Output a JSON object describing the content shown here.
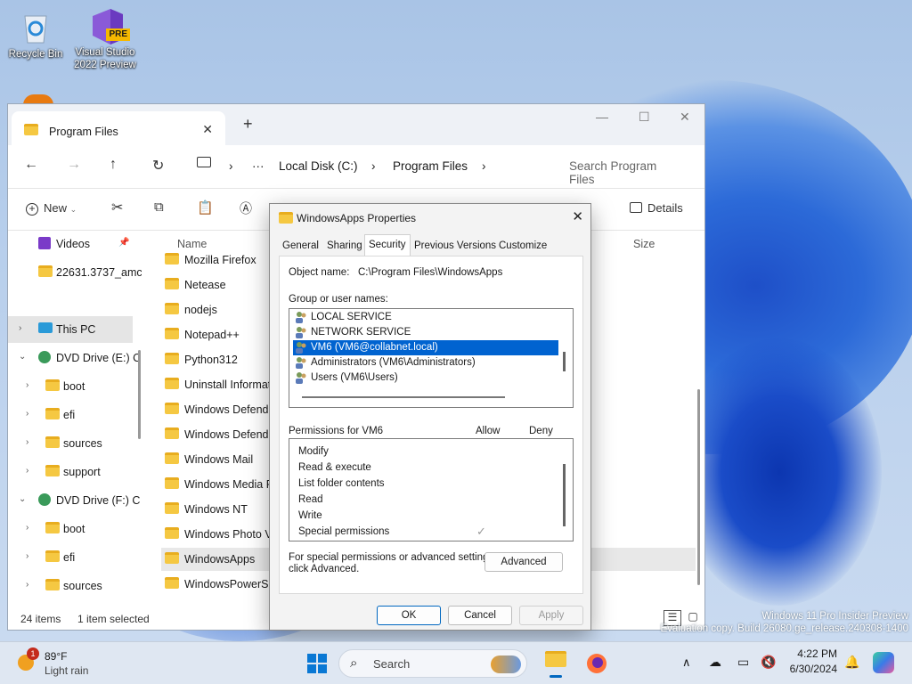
{
  "desktop": {
    "icons": [
      {
        "label": "Recycle Bin"
      },
      {
        "label": "Visual Studio 2022 Preview",
        "badge": "PRE"
      }
    ],
    "watermark_line1": "Windows 11 Pro Insider Preview",
    "watermark_line2": "Evaluation copy. Build 26080.ge_release.240308-1400"
  },
  "explorer": {
    "tab_title": "Program Files",
    "address": {
      "breadcrumb_1": "Local Disk (C:)",
      "breadcrumb_2": "Program Files",
      "search_placeholder": "Search Program Files"
    },
    "commands": {
      "new_label": "New",
      "details_label": "Details"
    },
    "nav": [
      {
        "label": "Videos"
      },
      {
        "label": "22631.3737_amc"
      },
      {
        "label": "This PC"
      },
      {
        "label": "DVD Drive (E:) C"
      },
      {
        "label": "boot"
      },
      {
        "label": "efi"
      },
      {
        "label": "sources"
      },
      {
        "label": "support"
      },
      {
        "label": "DVD Drive (F:) C"
      },
      {
        "label": "boot"
      },
      {
        "label": "efi"
      },
      {
        "label": "sources"
      }
    ],
    "columns": {
      "name": "Name",
      "size": "Size"
    },
    "files": [
      "Mozilla Firefox",
      "Netease",
      "nodejs",
      "Notepad++",
      "Python312",
      "Uninstall Informati",
      "Windows Defende",
      "Windows Defende",
      "Windows Mail",
      "Windows Media Pl",
      "Windows NT",
      "Windows Photo Vi",
      "WindowsApps",
      "WindowsPowerShe"
    ],
    "status": {
      "count": "24 items",
      "selected": "1 item selected"
    }
  },
  "dialog": {
    "title": "WindowsApps Properties",
    "tabs": [
      "General",
      "Sharing",
      "Security",
      "Previous Versions",
      "Customize"
    ],
    "active_tab": "Security",
    "object_name_label": "Object name:",
    "object_name_value": "C:\\Program Files\\WindowsApps",
    "group_label": "Group or user names:",
    "users": [
      "LOCAL SERVICE",
      "NETWORK SERVICE",
      "VM6 (VM6@collabnet.local)",
      "Administrators (VM6\\Administrators)",
      "Users (VM6\\Users)"
    ],
    "selected_user_index": 2,
    "permissions_label": "Permissions for VM6",
    "allow_label": "Allow",
    "deny_label": "Deny",
    "permissions": [
      "Modify",
      "Read & execute",
      "List folder contents",
      "Read",
      "Write",
      "Special permissions"
    ],
    "special_note_1": "For special permissions or advanced settings,",
    "special_note_2": "click Advanced.",
    "advanced_label": "Advanced",
    "ok_label": "OK",
    "cancel_label": "Cancel",
    "apply_label": "Apply"
  },
  "taskbar": {
    "weather_temp": "89°F",
    "weather_desc": "Light rain",
    "weather_badge": "1",
    "search_label": "Search",
    "time": "4:22 PM",
    "date": "6/30/2024"
  },
  "colors": {
    "accent": "#0063d0",
    "folder": "#f5c842"
  }
}
